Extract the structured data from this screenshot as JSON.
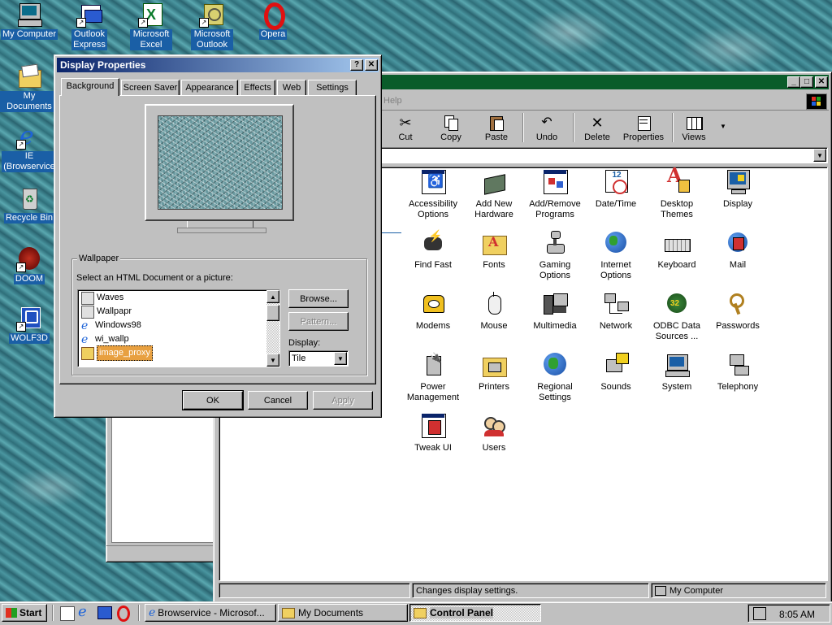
{
  "desktop": {
    "icons": [
      {
        "label": "My Computer"
      },
      {
        "label": "Outlook Express"
      },
      {
        "label": "Microsoft Excel"
      },
      {
        "label": "Microsoft Outlook"
      },
      {
        "label": "Opera"
      },
      {
        "label": "My Documents"
      },
      {
        "label": "IE (Browservice"
      },
      {
        "label": "Recycle Bin"
      },
      {
        "label": "DOOM"
      },
      {
        "label": "WOLF3D"
      }
    ]
  },
  "control_panel": {
    "menu_help": "Help",
    "toolbar": [
      {
        "label": "Cut",
        "icon": "scissors-icon"
      },
      {
        "label": "Copy",
        "icon": "copy-icon"
      },
      {
        "label": "Paste",
        "icon": "paste-icon"
      },
      {
        "label": "Undo",
        "icon": "undo-icon"
      },
      {
        "label": "Delete",
        "icon": "delete-icon"
      },
      {
        "label": "Properties",
        "icon": "properties-icon"
      },
      {
        "label": "Views",
        "icon": "views-icon"
      }
    ],
    "items": [
      {
        "label": "Accessibility Options"
      },
      {
        "label": "Add New Hardware"
      },
      {
        "label": "Add/Remove Programs"
      },
      {
        "label": "Date/Time"
      },
      {
        "label": "Desktop Themes"
      },
      {
        "label": "Display"
      },
      {
        "label": "Find Fast"
      },
      {
        "label": "Fonts"
      },
      {
        "label": "Gaming Options"
      },
      {
        "label": "Internet Options"
      },
      {
        "label": "Keyboard"
      },
      {
        "label": "Mail"
      },
      {
        "label": "Modems"
      },
      {
        "label": "Mouse"
      },
      {
        "label": "Multimedia"
      },
      {
        "label": "Network"
      },
      {
        "label": "ODBC Data Sources ..."
      },
      {
        "label": "Passwords"
      },
      {
        "label": "Power Management"
      },
      {
        "label": "Printers"
      },
      {
        "label": "Regional Settings"
      },
      {
        "label": "Sounds"
      },
      {
        "label": "System"
      },
      {
        "label": "Telephony"
      },
      {
        "label": "Tweak UI"
      },
      {
        "label": "Users"
      }
    ],
    "status_left": "Changes display settings.",
    "status_right": "My Computer"
  },
  "dialog": {
    "title": "Display Properties",
    "tabs": [
      "Background",
      "Screen Saver",
      "Appearance",
      "Effects",
      "Web",
      "Settings"
    ],
    "wallpaper_group": "Wallpaper",
    "select_label": "Select an HTML Document or a picture:",
    "list": [
      "Waves",
      "Wallpapr",
      "Windows98",
      "wi_wallp",
      "image_proxy"
    ],
    "selected": "image_proxy",
    "browse": "Browse...",
    "pattern": "Pattern...",
    "display_label": "Display:",
    "display_value": "Tile",
    "ok": "OK",
    "cancel": "Cancel",
    "apply": "Apply"
  },
  "taskbar": {
    "start": "Start",
    "tasks": [
      {
        "label": "Browservice - Microsof..."
      },
      {
        "label": "My Documents"
      },
      {
        "label": "Control Panel"
      }
    ],
    "clock": "8:05 AM"
  },
  "colors": {
    "titlebar_active": "#0a246a",
    "desktop_label_bg": "#1a5fa6",
    "highlight": "#e8a040"
  }
}
